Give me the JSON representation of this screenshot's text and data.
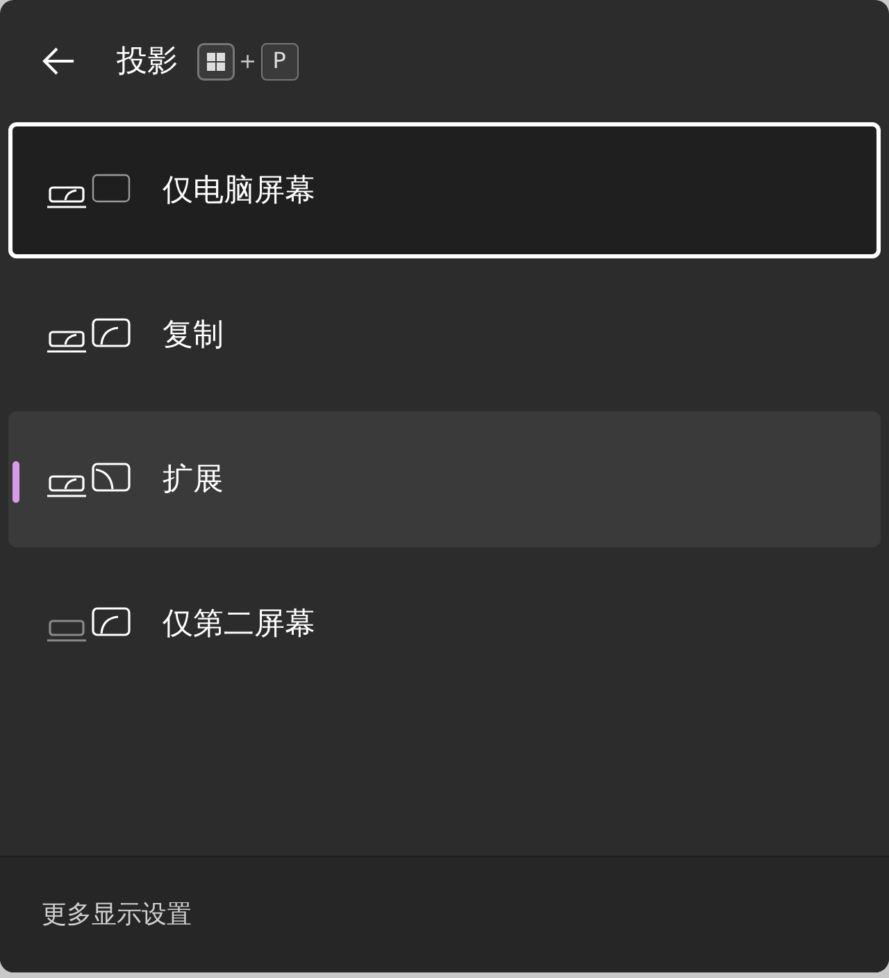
{
  "header": {
    "title": "投影",
    "shortcut": {
      "plus": "+",
      "key": "P"
    }
  },
  "options": [
    {
      "kind": "pc_only",
      "label": "仅电脑屏幕",
      "selected": false,
      "focused": true
    },
    {
      "kind": "duplicate",
      "label": "复制",
      "selected": false,
      "focused": false
    },
    {
      "kind": "extend",
      "label": "扩展",
      "selected": true,
      "focused": false
    },
    {
      "kind": "second_only",
      "label": "仅第二屏幕",
      "selected": false,
      "focused": false
    }
  ],
  "footer": {
    "link": "更多显示设置"
  }
}
